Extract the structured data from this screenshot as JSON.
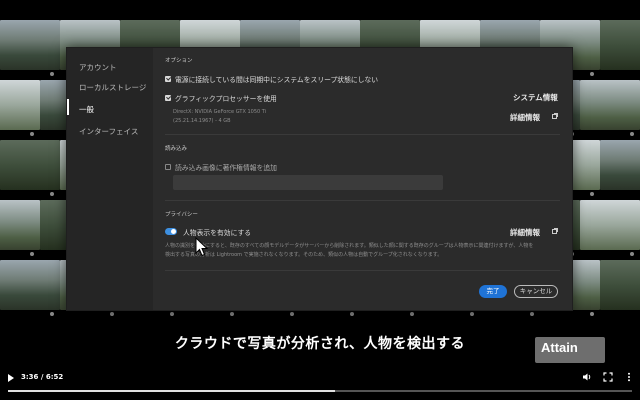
{
  "sidebar": {
    "items": [
      {
        "label": "アカウント",
        "active": false
      },
      {
        "label": "ローカルストレージ",
        "active": false
      },
      {
        "label": "一般",
        "active": true
      },
      {
        "label": "インターフェイス",
        "active": false
      }
    ]
  },
  "options": {
    "section_title": "オプション",
    "sleep_label": "電源に接続している間は同期中にシステムをスリープ状態にしない",
    "gpu_label": "グラフィックプロセッサーを使用",
    "system_info_label": "システム情報",
    "gpu_detail_line1": "DirectX: NVIDIA GeForce GTX 1050 Ti",
    "gpu_detail_line2": "(25.21.14.1967) - 4 GB",
    "details_label": "詳細情報"
  },
  "import": {
    "section_title": "読み込み",
    "copyright_label": "読み込み画像に著作権情報を追加",
    "copyright_value": ""
  },
  "privacy": {
    "section_title": "プライバシー",
    "people_label": "人物表示を有効にする",
    "details_label": "詳細情報",
    "desc_line1": "人物の識別を有効にすると、既存のすべての顔モデルデータがサーバーから削除されます。類似した顔に関する既存のグループは人物表示に関連付けますが、人物を",
    "desc_line2": "検出する写真の分析は Lightroom で実施されなくなります。そのため、類似の人物は自動でグループ化されなくなります。"
  },
  "buttons": {
    "done": "完了",
    "cancel": "キャンセル"
  },
  "subtitle": "クラウドで写真が分析され、人物を検出する",
  "watermark": "Attain",
  "player": {
    "time": "3:36 / 6:52",
    "progress": 0.524
  },
  "colors": {
    "accent": "#1f73d6",
    "toggle": "#3d8fe0"
  }
}
